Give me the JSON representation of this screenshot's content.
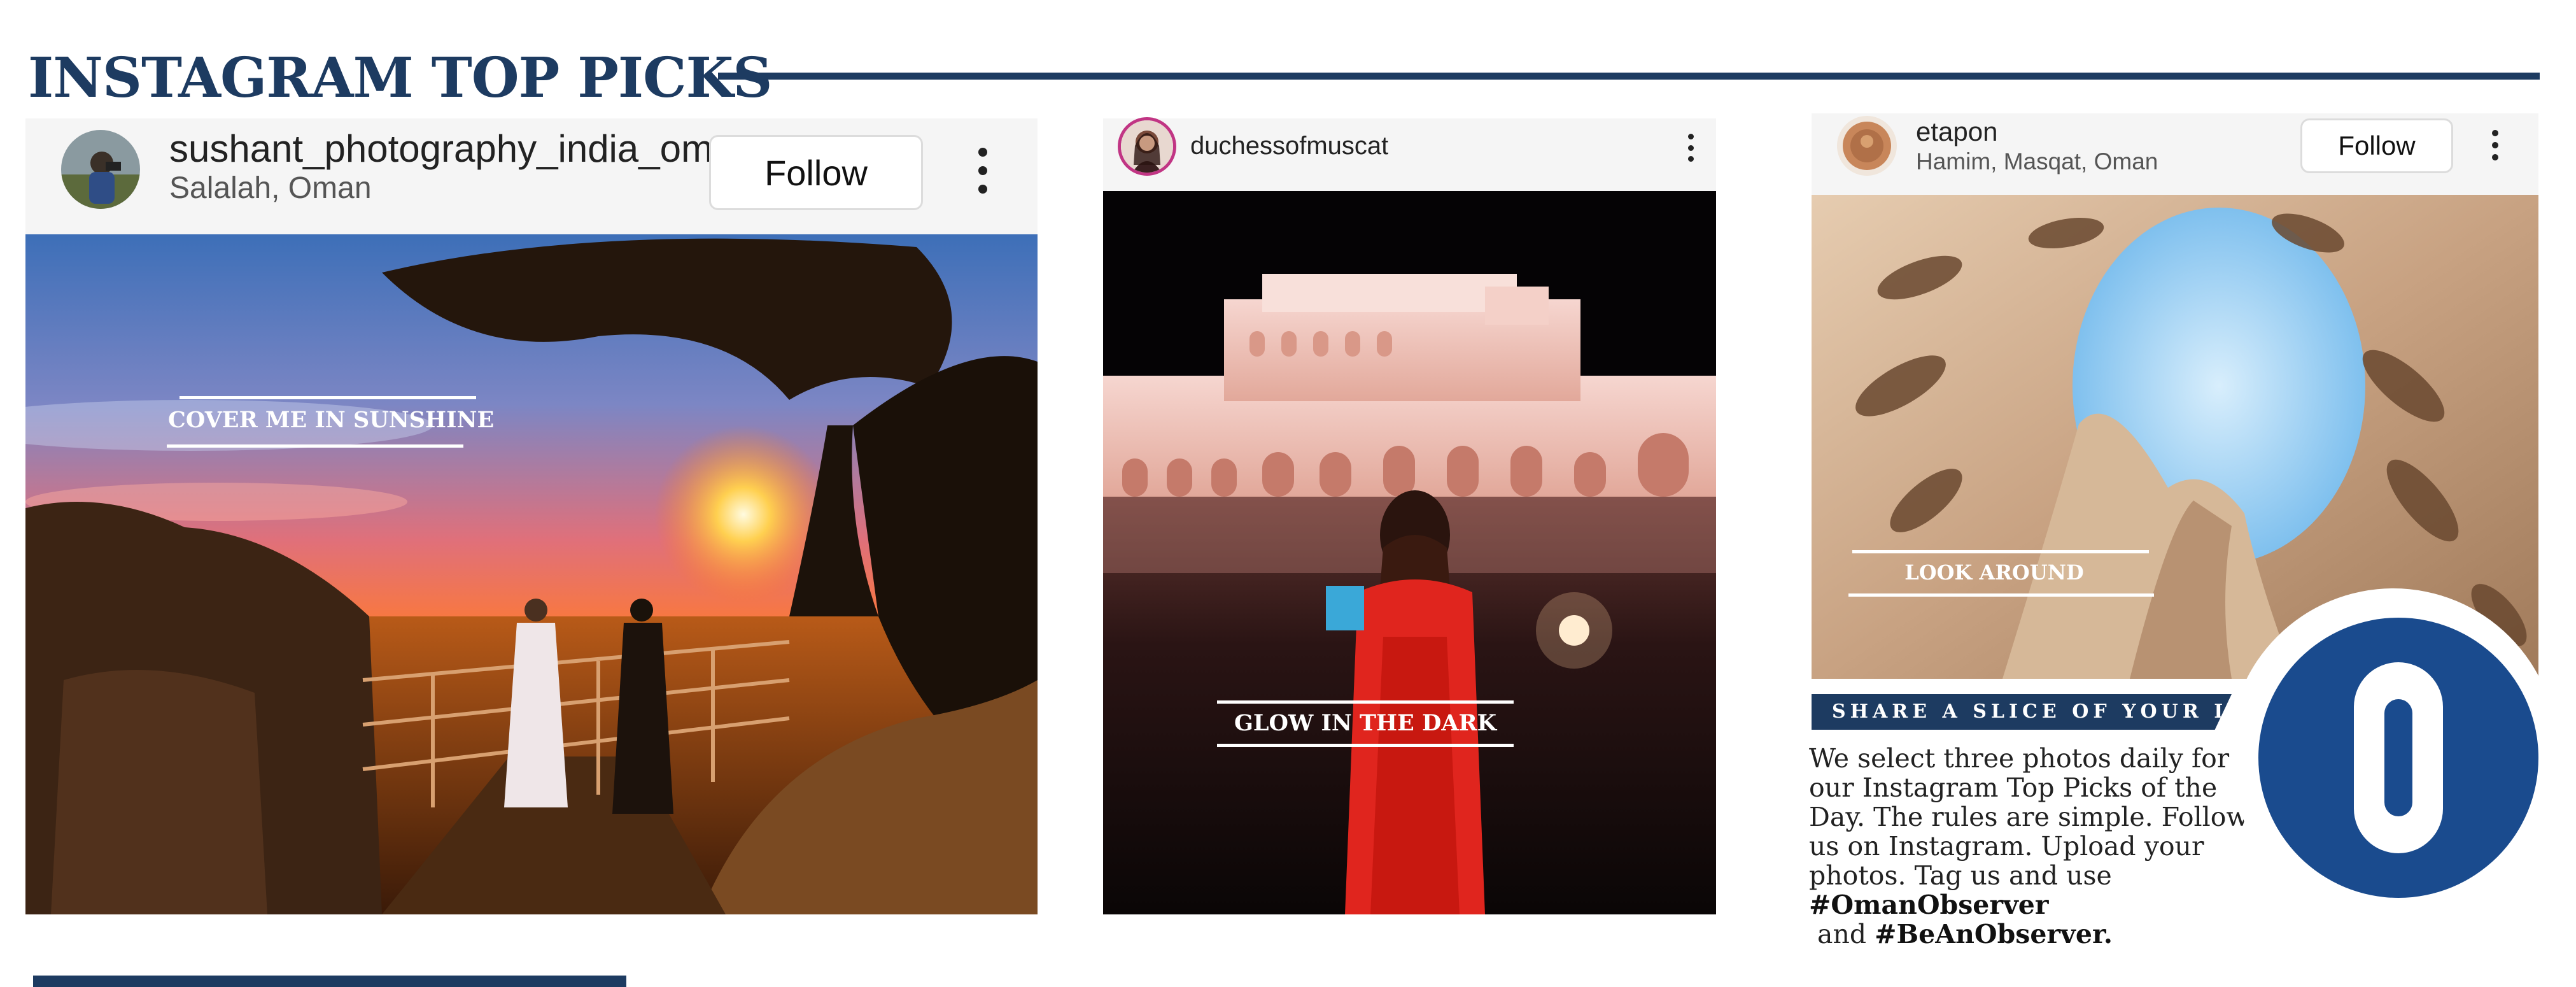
{
  "page": {
    "title": "INSTAGRAM TOP PICKS"
  },
  "posts": [
    {
      "username": "sushant_photography_india_oman",
      "location": "Salalah, Oman",
      "follow_label": "Follow",
      "caption": "COVER ME IN SUNSHINE"
    },
    {
      "username": "duchessofmuscat",
      "caption": "GLOW IN THE DARK"
    },
    {
      "username": "etapon",
      "location": "Hamim, Masqat, Oman",
      "follow_label": "Follow",
      "caption": "LOOK AROUND"
    }
  ],
  "share": {
    "heading": "SHARE A SLICE OF YOUR LIFE",
    "line1": "We select three photos daily for",
    "line2": "our Instagram Top Picks of the",
    "line3": "Day. The rules are simple. Follow",
    "line4": "us on Instagram. Upload your",
    "line5": "photos. Tag us and use",
    "hashtag1": "#OmanObserver",
    "and_word": " and ",
    "hashtag2": "#BeAnObserver."
  },
  "logo": {
    "letter": "O"
  },
  "colors": {
    "navy": "#1d3b61",
    "logo_blue": "#1a4b8e"
  }
}
